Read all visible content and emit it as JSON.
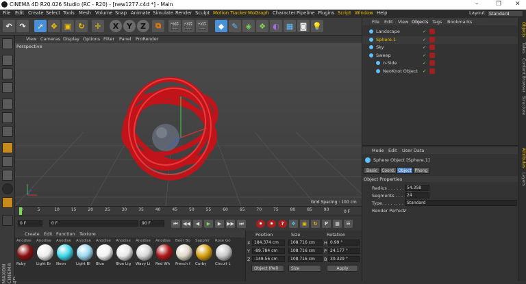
{
  "title": "CINEMA 4D R20.026 Studio (RC - R20) - [new1277.c4d *] - Main",
  "window_controls": [
    "–",
    "❐",
    "✕"
  ],
  "menu": [
    "File",
    "Edit",
    "Create",
    "Select",
    "Tools",
    "Mesh",
    "Volume",
    "Snap",
    "Animate",
    "Simulate",
    "Render",
    "Sculpt",
    "Motion Tracker",
    "MoGraph",
    "Character",
    "Pipeline",
    "Plugins",
    "Script",
    "Window",
    "Help"
  ],
  "layout": {
    "label": "Layout:",
    "value": "Standard"
  },
  "toolbar_letters": [
    "X",
    "Y",
    "Z"
  ],
  "viewport": {
    "menu": [
      "View",
      "Cameras",
      "Display",
      "Options",
      "Filter",
      "Panel",
      "ProRender"
    ],
    "label": "Perspective",
    "grid_spacing": "Grid Spacing : 100 cm"
  },
  "timeline": {
    "ticks": [
      "0",
      "5",
      "10",
      "15",
      "20",
      "25",
      "30",
      "35",
      "40",
      "45",
      "50",
      "55",
      "60",
      "65",
      "70",
      "75",
      "80",
      "85",
      "90"
    ],
    "end_frame": "0 F"
  },
  "playback": {
    "start": "0 F",
    "current": "0 F",
    "end": "90 F",
    "end2": "90 F"
  },
  "materials": {
    "menu": [
      "Create",
      "Edit",
      "Function",
      "Texture"
    ],
    "items": [
      {
        "name": "Ruby",
        "color": "#8c1010"
      },
      {
        "name": "Light Br",
        "color": "#ededed"
      },
      {
        "name": "Neon",
        "color": "#3fd6e8"
      },
      {
        "name": "Light Bl",
        "color": "#9ad8ef"
      },
      {
        "name": "Blue",
        "color": "#f2f2f2"
      },
      {
        "name": "Blue Lig",
        "color": "#e9e9e9"
      },
      {
        "name": "Wavy Li",
        "color": "#d8d8d8"
      },
      {
        "name": "Red Wh",
        "color": "#b01818"
      },
      {
        "name": "French f",
        "color": "#e0d9c8"
      },
      {
        "name": "Curby",
        "color": "#d7a010"
      },
      {
        "name": "Circuit L",
        "color": "#c8c8c8"
      }
    ],
    "top_names": [
      "Anodise",
      "Anodise",
      "Anodise",
      "Anodise",
      "Anodise",
      "Anodise",
      "Anodise",
      "Anodise",
      "Beer Bo",
      "Sapphir",
      "Rose Go"
    ]
  },
  "coords": {
    "headers": [
      "Position",
      "Size",
      "Rotation"
    ],
    "rows": [
      {
        "axis": "X",
        "pos": "184.374 cm",
        "size": "108.716 cm",
        "rot_axis": "H",
        "rot": "0.99 °"
      },
      {
        "axis": "Y",
        "pos": "-89.784 cm",
        "size": "108.716 cm",
        "rot_axis": "P",
        "rot": "24.177 °"
      },
      {
        "axis": "Z",
        "pos": "-149.56 cm",
        "size": "108.716 cm",
        "rot_axis": "B",
        "rot": "30.329 °"
      }
    ],
    "mode": "Object (Rel)",
    "size_mode": "Size",
    "apply": "Apply"
  },
  "objects": {
    "menu": [
      "File",
      "Edit",
      "View",
      "Objects",
      "Tags",
      "Bookmarks"
    ],
    "rows": [
      {
        "name": "Landscape",
        "color": "#cfcfcf",
        "indent": 0
      },
      {
        "name": "Sphere.1",
        "color": "#f0c000",
        "indent": 0
      },
      {
        "name": "Sky",
        "color": "#cfcfcf",
        "indent": 0
      },
      {
        "name": "Sweep",
        "color": "#cfcfcf",
        "indent": 0
      },
      {
        "name": "n-Side",
        "color": "#cfcfcf",
        "indent": 1
      },
      {
        "name": "NeoKnot Object",
        "color": "#cfcfcf",
        "indent": 1
      }
    ]
  },
  "attributes": {
    "menu": [
      "Mode",
      "Edit",
      "User Data"
    ],
    "object_title": "Sphere Object [Sphere.1]",
    "tabs": [
      "Basic",
      "Coord.",
      "Object",
      "Phong"
    ],
    "active_tab": "Object",
    "section": "Object Properties",
    "props": [
      {
        "label": "Radius . . . . . . . . .",
        "value": "54.358 cm"
      },
      {
        "label": "Segments . . . . . . .",
        "value": "24"
      },
      {
        "label": "Type. . . . . . . . . . .",
        "value": "Standard"
      },
      {
        "label": "Render Perfect",
        "value": "✓"
      }
    ]
  },
  "side_tabs": [
    "Objects",
    "Takes",
    "Content Browser",
    "Structure",
    "Attributes",
    "Layers"
  ],
  "brand": "MAXON CINEMA 4D"
}
